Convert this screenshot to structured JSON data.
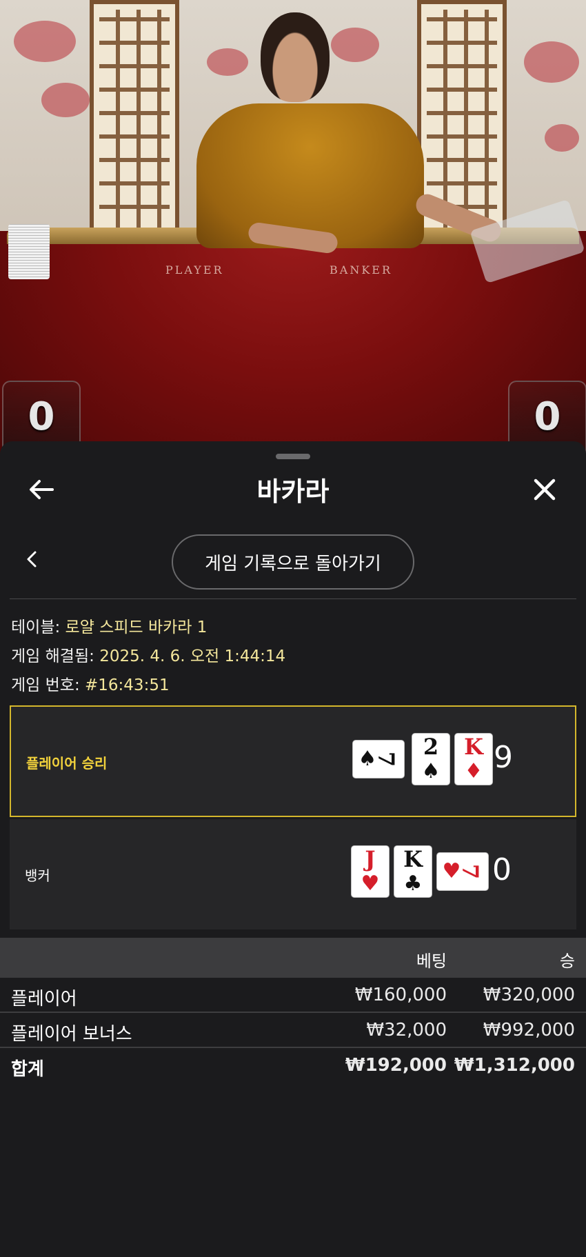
{
  "video": {
    "table_labels": [
      "PLAYER",
      "BANKER"
    ],
    "player_score": "0",
    "banker_score": "0"
  },
  "sheet": {
    "title": "바카라",
    "history_button": "게임 기록으로 돌아가기",
    "info": {
      "table_label": "테이블:",
      "table_value": "로얄 스피드 바카라 1",
      "resolved_label": "게임 해결됨:",
      "resolved_value": "2025. 4. 6. 오전 1:44:14",
      "game_no_label": "게임 번호:",
      "game_no_value": "#16:43:51"
    },
    "hands": [
      {
        "label": "플레이어 승리",
        "total": "9",
        "winner": true,
        "cards": [
          {
            "rank": "7",
            "suit": "♠",
            "color": "black",
            "sideways": true
          },
          {
            "rank": "2",
            "suit": "♠",
            "color": "black",
            "sideways": false
          },
          {
            "rank": "K",
            "suit": "♦",
            "color": "red",
            "sideways": false
          }
        ]
      },
      {
        "label": "뱅커",
        "total": "0",
        "winner": false,
        "cards": [
          {
            "rank": "J",
            "suit": "♥",
            "color": "red",
            "sideways": false
          },
          {
            "rank": "K",
            "suit": "♣",
            "color": "black",
            "sideways": false
          },
          {
            "rank": "7",
            "suit": "♥",
            "color": "red",
            "sideways": true
          }
        ]
      }
    ],
    "bets": {
      "columns": [
        "베팅",
        "승"
      ],
      "rows": [
        {
          "name": "플레이어",
          "bet": "₩160,000",
          "win": "₩320,000"
        },
        {
          "name": "플레이어 보너스",
          "bet": "₩32,000",
          "win": "₩992,000"
        }
      ],
      "total": {
        "name": "합계",
        "bet": "₩192,000",
        "win": "₩1,312,000"
      }
    }
  },
  "icons": {
    "back": "arrow-left-icon",
    "close": "close-icon",
    "prev": "chevron-left-icon"
  },
  "colors": {
    "winner_accent": "#d4b72c",
    "info_value": "#f4e79c",
    "sheet_bg": "#1b1b1d"
  }
}
